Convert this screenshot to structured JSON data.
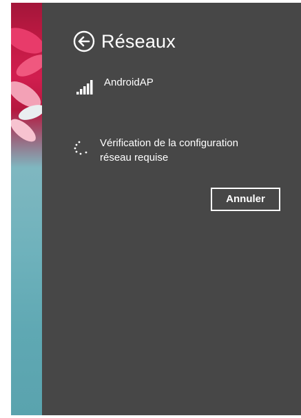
{
  "panel": {
    "title": "Réseaux",
    "back_icon": "back-arrow-circle-icon",
    "background_color": "#474747"
  },
  "network": {
    "name": "AndroidAP",
    "signal_icon": "wifi-signal-bars-icon",
    "signal_strength": "5 of 5 bars"
  },
  "status": {
    "icon": "loading-spinner-icon",
    "text": "Vérification de la configuration réseau requise"
  },
  "actions": {
    "cancel_label": "Annuler"
  }
}
